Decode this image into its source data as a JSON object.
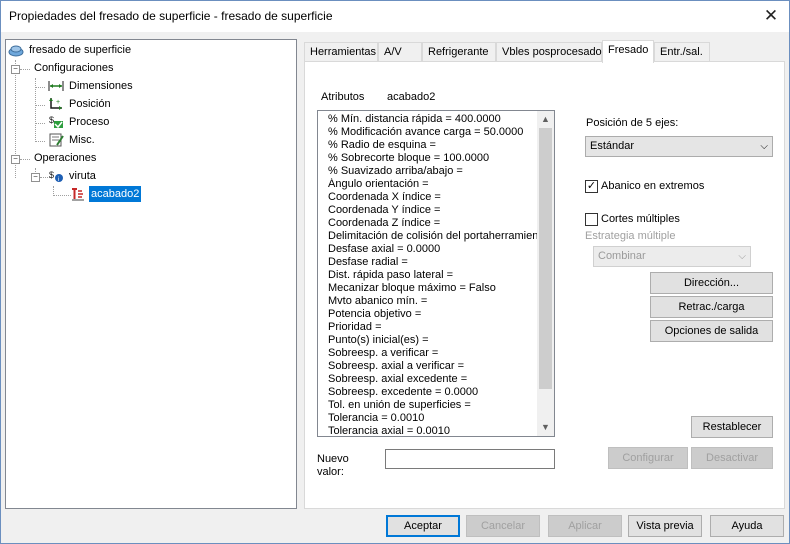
{
  "window": {
    "title": "Propiedades del fresado de superficie - fresado de superficie"
  },
  "tree": {
    "root": "fresado de superficie",
    "configuraciones": "Configuraciones",
    "dimensiones": "Dimensiones",
    "posicion": "Posición",
    "proceso": "Proceso",
    "misc": "Misc.",
    "operaciones": "Operaciones",
    "viruta": "viruta",
    "acabado2": "acabado2"
  },
  "tabs": [
    {
      "label": "Herramientas"
    },
    {
      "label": "A/V"
    },
    {
      "label": "Refrigerante"
    },
    {
      "label": "Vbles posprocesado"
    },
    {
      "label": "Fresado"
    },
    {
      "label": "Entr./sal."
    }
  ],
  "attributes": {
    "label": "Atributos",
    "value": "acabado2",
    "items": [
      "% Mín. distancia rápida = 400.0000",
      "% Modificación avance carga = 50.0000",
      "% Radio de esquina =",
      "% Sobrecorte bloque = 100.0000",
      "% Suavizado arriba/abajo =",
      "Ángulo orientación =",
      "Coordenada X índice =",
      "Coordenada Y índice =",
      "Coordenada Z índice =",
      "Delimitación de colisión del portaherramienta",
      "Desfase axial = 0.0000",
      "Desfase radial  =",
      "Dist. rápida paso lateral =",
      "Mecanizar bloque máximo = Falso",
      "Mvto abanico mín. =",
      "Potencia objetivo  =",
      "Prioridad =",
      "Punto(s) inicial(es) =",
      "Sobreesp. a verificar =",
      "Sobreesp. axial a verificar =",
      "Sobreesp. axial excedente =",
      "Sobreesp. excedente = 0.0000",
      "Tol. en unión de superficies =",
      "Tolerancia = 0.0010",
      "Tolerancia axial = 0.0010"
    ]
  },
  "new_value": {
    "label_line1": "Nuevo",
    "label_line2": "valor:",
    "value": ""
  },
  "five_axis": {
    "label": "Posición de 5 ejes:",
    "selected": "Estándar"
  },
  "abanico": {
    "label": "Abanico en extremos",
    "checked": true
  },
  "cortes": {
    "label": "Cortes múltiples",
    "checked": false
  },
  "estrategia": {
    "label": "Estrategia múltiple",
    "selected": "Combinar"
  },
  "buttons": {
    "direccion": "Dirección...",
    "retrac": "Retrac./carga",
    "opciones": "Opciones de salida",
    "restablecer": "Restablecer",
    "configurar": "Configurar",
    "desactivar": "Desactivar",
    "aceptar": "Aceptar",
    "cancelar": "Cancelar",
    "aplicar": "Aplicar",
    "vista_previa": "Vista previa",
    "ayuda": "Ayuda"
  },
  "colors": {
    "selection": "#0078d7",
    "accent_border": "#0078d7"
  }
}
